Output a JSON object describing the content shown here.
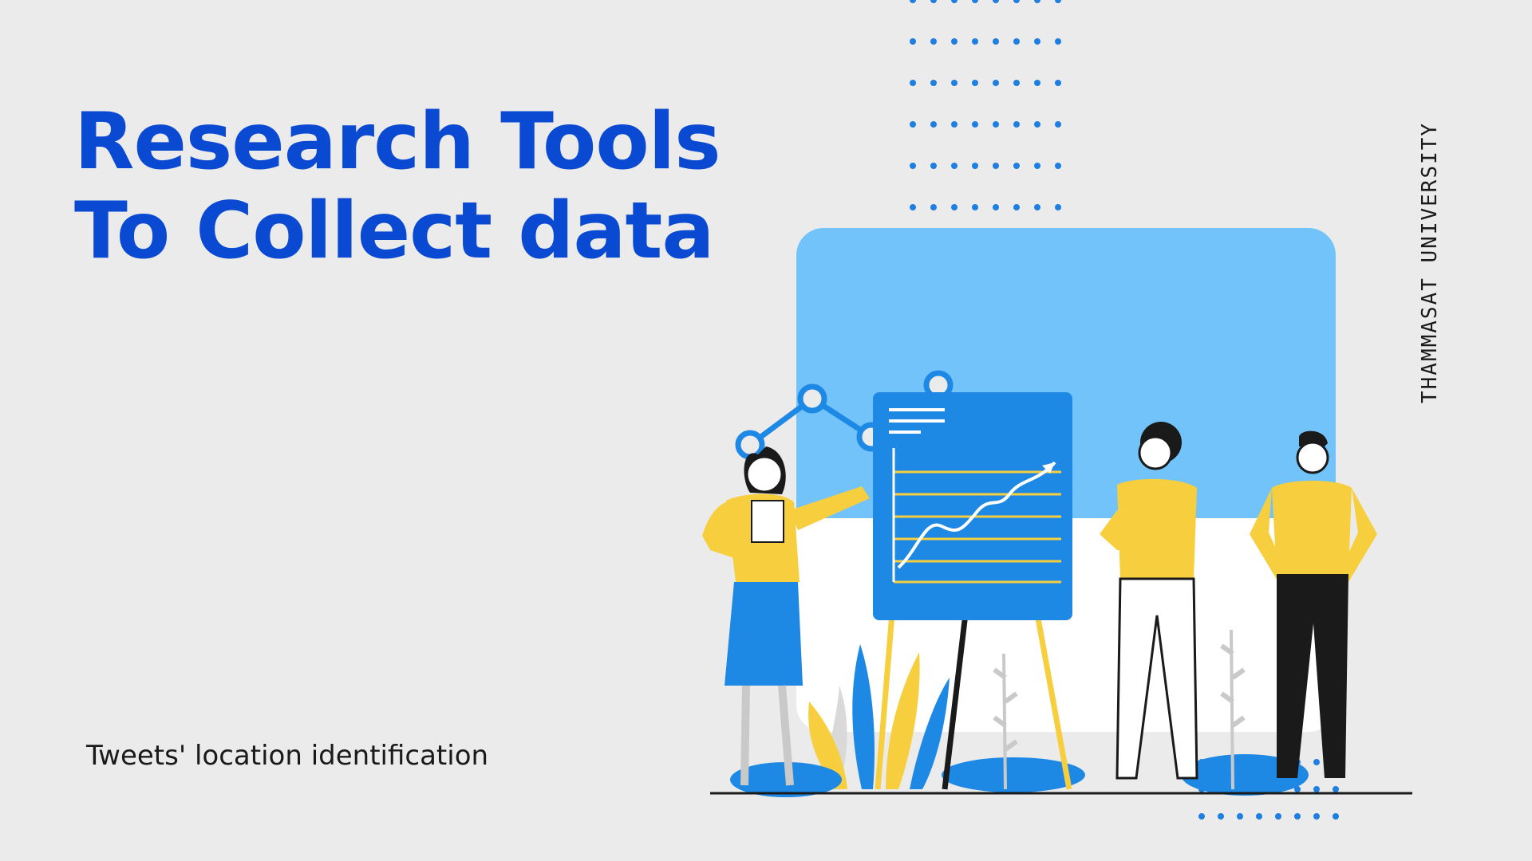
{
  "slide": {
    "title_line1": "Research Tools",
    "title_line2": "To Collect data",
    "subtitle": "Tweets' location identification",
    "vertical_label": "THAMMASAT UNIVERSITY"
  },
  "colors": {
    "background": "#ebebeb",
    "title": "#0a49d1",
    "accent_blue": "#1e88e5",
    "light_blue": "#73c3fb",
    "yellow": "#f7ce3e",
    "dot_blue": "#1e7fe0",
    "text_dark": "#1a1a1a"
  },
  "illustration": {
    "subject": "people-presenting-chart",
    "icons": [
      "rising-line-chart-icon",
      "connector-dots-icon",
      "plants-decoration",
      "dot-grid-decoration"
    ]
  }
}
